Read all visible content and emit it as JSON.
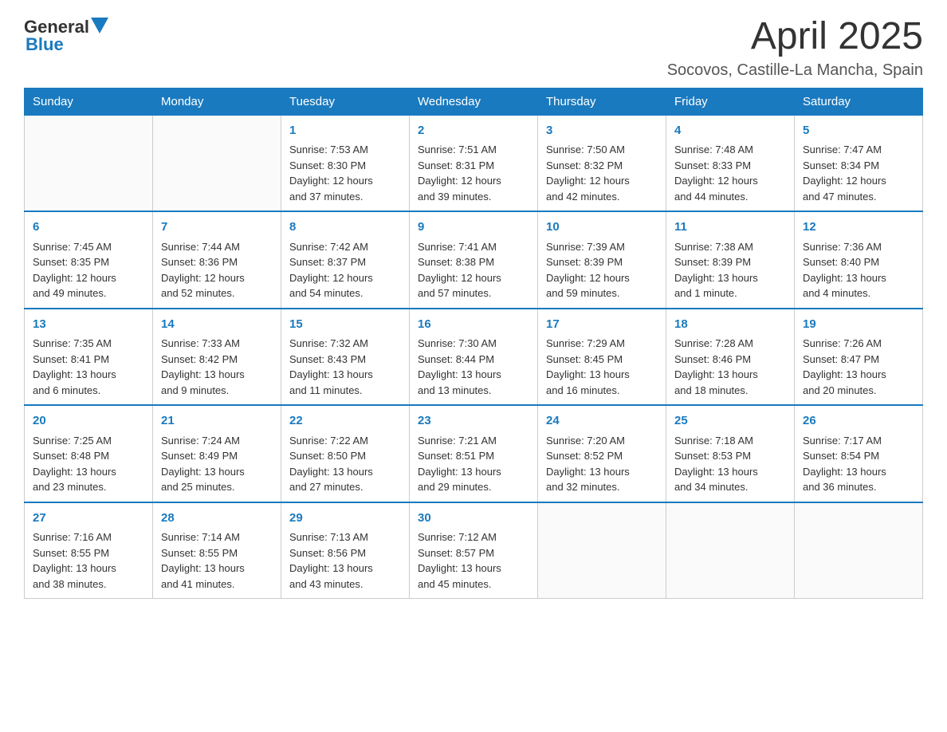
{
  "header": {
    "logo_general": "General",
    "logo_blue": "Blue",
    "month_year": "April 2025",
    "location": "Socovos, Castille-La Mancha, Spain"
  },
  "days_of_week": [
    "Sunday",
    "Monday",
    "Tuesday",
    "Wednesday",
    "Thursday",
    "Friday",
    "Saturday"
  ],
  "weeks": [
    [
      {
        "day": "",
        "info": ""
      },
      {
        "day": "",
        "info": ""
      },
      {
        "day": "1",
        "info": "Sunrise: 7:53 AM\nSunset: 8:30 PM\nDaylight: 12 hours\nand 37 minutes."
      },
      {
        "day": "2",
        "info": "Sunrise: 7:51 AM\nSunset: 8:31 PM\nDaylight: 12 hours\nand 39 minutes."
      },
      {
        "day": "3",
        "info": "Sunrise: 7:50 AM\nSunset: 8:32 PM\nDaylight: 12 hours\nand 42 minutes."
      },
      {
        "day": "4",
        "info": "Sunrise: 7:48 AM\nSunset: 8:33 PM\nDaylight: 12 hours\nand 44 minutes."
      },
      {
        "day": "5",
        "info": "Sunrise: 7:47 AM\nSunset: 8:34 PM\nDaylight: 12 hours\nand 47 minutes."
      }
    ],
    [
      {
        "day": "6",
        "info": "Sunrise: 7:45 AM\nSunset: 8:35 PM\nDaylight: 12 hours\nand 49 minutes."
      },
      {
        "day": "7",
        "info": "Sunrise: 7:44 AM\nSunset: 8:36 PM\nDaylight: 12 hours\nand 52 minutes."
      },
      {
        "day": "8",
        "info": "Sunrise: 7:42 AM\nSunset: 8:37 PM\nDaylight: 12 hours\nand 54 minutes."
      },
      {
        "day": "9",
        "info": "Sunrise: 7:41 AM\nSunset: 8:38 PM\nDaylight: 12 hours\nand 57 minutes."
      },
      {
        "day": "10",
        "info": "Sunrise: 7:39 AM\nSunset: 8:39 PM\nDaylight: 12 hours\nand 59 minutes."
      },
      {
        "day": "11",
        "info": "Sunrise: 7:38 AM\nSunset: 8:39 PM\nDaylight: 13 hours\nand 1 minute."
      },
      {
        "day": "12",
        "info": "Sunrise: 7:36 AM\nSunset: 8:40 PM\nDaylight: 13 hours\nand 4 minutes."
      }
    ],
    [
      {
        "day": "13",
        "info": "Sunrise: 7:35 AM\nSunset: 8:41 PM\nDaylight: 13 hours\nand 6 minutes."
      },
      {
        "day": "14",
        "info": "Sunrise: 7:33 AM\nSunset: 8:42 PM\nDaylight: 13 hours\nand 9 minutes."
      },
      {
        "day": "15",
        "info": "Sunrise: 7:32 AM\nSunset: 8:43 PM\nDaylight: 13 hours\nand 11 minutes."
      },
      {
        "day": "16",
        "info": "Sunrise: 7:30 AM\nSunset: 8:44 PM\nDaylight: 13 hours\nand 13 minutes."
      },
      {
        "day": "17",
        "info": "Sunrise: 7:29 AM\nSunset: 8:45 PM\nDaylight: 13 hours\nand 16 minutes."
      },
      {
        "day": "18",
        "info": "Sunrise: 7:28 AM\nSunset: 8:46 PM\nDaylight: 13 hours\nand 18 minutes."
      },
      {
        "day": "19",
        "info": "Sunrise: 7:26 AM\nSunset: 8:47 PM\nDaylight: 13 hours\nand 20 minutes."
      }
    ],
    [
      {
        "day": "20",
        "info": "Sunrise: 7:25 AM\nSunset: 8:48 PM\nDaylight: 13 hours\nand 23 minutes."
      },
      {
        "day": "21",
        "info": "Sunrise: 7:24 AM\nSunset: 8:49 PM\nDaylight: 13 hours\nand 25 minutes."
      },
      {
        "day": "22",
        "info": "Sunrise: 7:22 AM\nSunset: 8:50 PM\nDaylight: 13 hours\nand 27 minutes."
      },
      {
        "day": "23",
        "info": "Sunrise: 7:21 AM\nSunset: 8:51 PM\nDaylight: 13 hours\nand 29 minutes."
      },
      {
        "day": "24",
        "info": "Sunrise: 7:20 AM\nSunset: 8:52 PM\nDaylight: 13 hours\nand 32 minutes."
      },
      {
        "day": "25",
        "info": "Sunrise: 7:18 AM\nSunset: 8:53 PM\nDaylight: 13 hours\nand 34 minutes."
      },
      {
        "day": "26",
        "info": "Sunrise: 7:17 AM\nSunset: 8:54 PM\nDaylight: 13 hours\nand 36 minutes."
      }
    ],
    [
      {
        "day": "27",
        "info": "Sunrise: 7:16 AM\nSunset: 8:55 PM\nDaylight: 13 hours\nand 38 minutes."
      },
      {
        "day": "28",
        "info": "Sunrise: 7:14 AM\nSunset: 8:55 PM\nDaylight: 13 hours\nand 41 minutes."
      },
      {
        "day": "29",
        "info": "Sunrise: 7:13 AM\nSunset: 8:56 PM\nDaylight: 13 hours\nand 43 minutes."
      },
      {
        "day": "30",
        "info": "Sunrise: 7:12 AM\nSunset: 8:57 PM\nDaylight: 13 hours\nand 45 minutes."
      },
      {
        "day": "",
        "info": ""
      },
      {
        "day": "",
        "info": ""
      },
      {
        "day": "",
        "info": ""
      }
    ]
  ]
}
